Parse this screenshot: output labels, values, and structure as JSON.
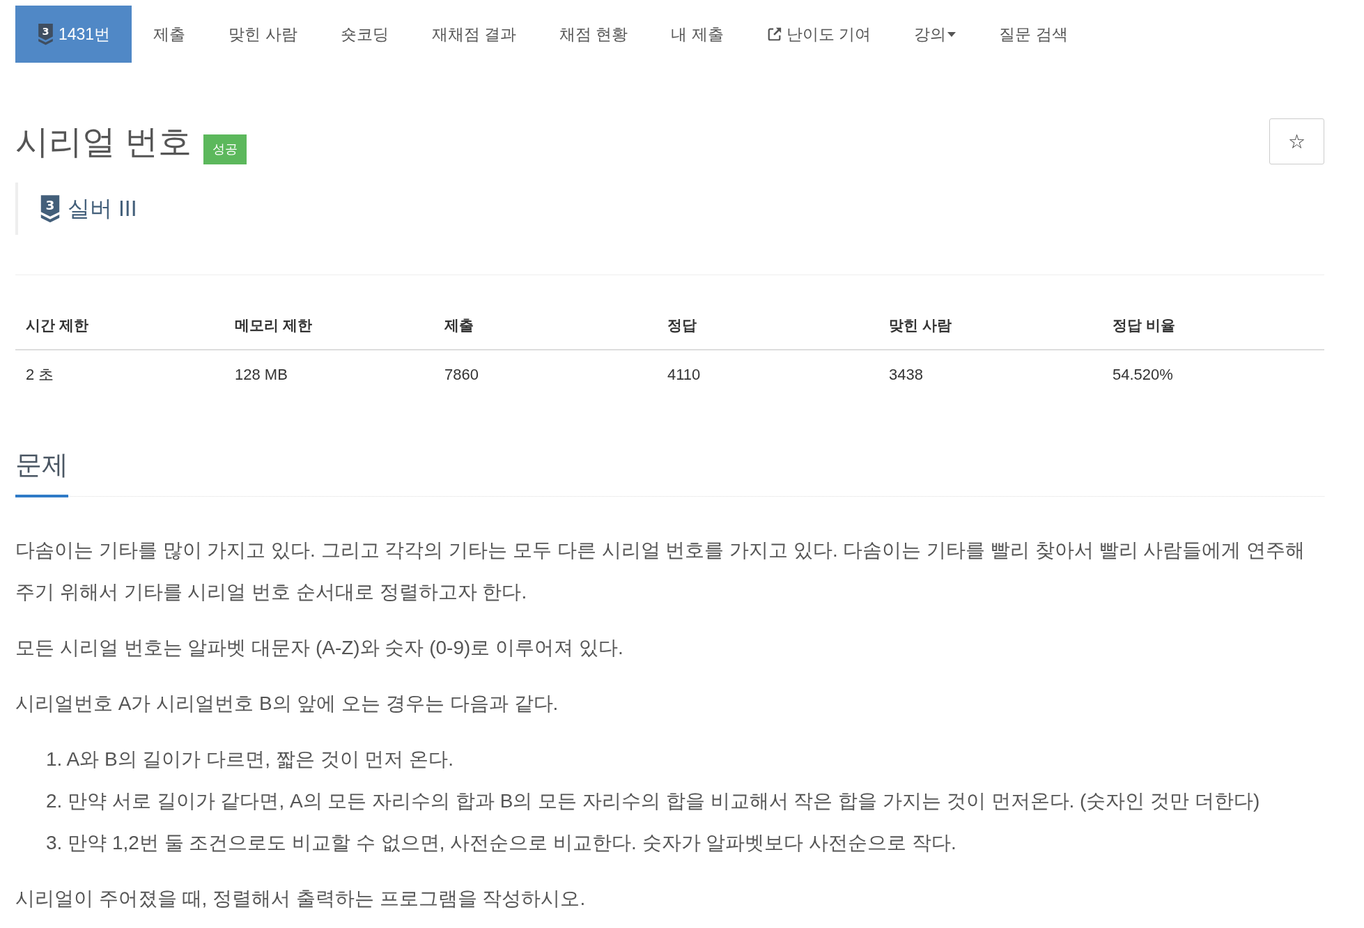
{
  "nav": {
    "tabs": [
      {
        "label": "1431번",
        "kind": "problem",
        "tier_number": "3",
        "selected": true
      },
      {
        "label": "제출",
        "kind": "link",
        "selected": false
      },
      {
        "label": "맞힌 사람",
        "kind": "link",
        "selected": false
      },
      {
        "label": "숏코딩",
        "kind": "link",
        "selected": false
      },
      {
        "label": "재채점 결과",
        "kind": "link",
        "selected": false
      },
      {
        "label": "채점 현황",
        "kind": "link",
        "selected": false
      },
      {
        "label": "내 제출",
        "kind": "link",
        "selected": false
      },
      {
        "label": "난이도 기여",
        "kind": "external",
        "selected": false
      },
      {
        "label": "강의",
        "kind": "dropdown",
        "selected": false
      },
      {
        "label": "질문 검색",
        "kind": "link",
        "selected": false
      }
    ]
  },
  "problem": {
    "title": "시리얼 번호",
    "result_badge": "성공",
    "star_button": "☆",
    "tier": {
      "number": "3",
      "label": "실버 III"
    }
  },
  "stats": {
    "columns": [
      "시간 제한",
      "메모리 제한",
      "제출",
      "정답",
      "맞힌 사람",
      "정답 비율"
    ],
    "rows": [
      [
        "2 초",
        "128 MB",
        "7860",
        "4110",
        "3438",
        "54.520%"
      ]
    ]
  },
  "description": {
    "heading": "문제",
    "blocks": [
      {
        "kind": "paragraph",
        "text": "다솜이는 기타를 많이 가지고 있다. 그리고 각각의 기타는 모두 다른 시리얼 번호를 가지고 있다. 다솜이는 기타를 빨리 찾아서 빨리 사람들에게 연주해주기 위해서 기타를 시리얼 번호 순서대로 정렬하고자 한다."
      },
      {
        "kind": "paragraph",
        "text": "모든 시리얼 번호는 알파벳 대문자 (A-Z)와 숫자 (0-9)로 이루어져 있다."
      },
      {
        "kind": "paragraph",
        "text": "시리얼번호 A가 시리얼번호 B의 앞에 오는 경우는 다음과 같다."
      },
      {
        "kind": "list",
        "items": [
          "1. A와 B의 길이가 다르면, 짧은 것이 먼저 온다.",
          "2. 만약 서로 길이가 같다면, A의 모든 자리수의 합과 B의 모든 자리수의 합을 비교해서 작은 합을 가지는 것이 먼저온다. (숫자인 것만 더한다)",
          "3. 만약 1,2번 둘 조건으로도 비교할 수 없으면, 사전순으로 비교한다. 숫자가 알파벳보다 사전순으로 작다."
        ]
      },
      {
        "kind": "paragraph",
        "text": "시리얼이 주어졌을 때, 정렬해서 출력하는 프로그램을 작성하시오."
      }
    ]
  }
}
